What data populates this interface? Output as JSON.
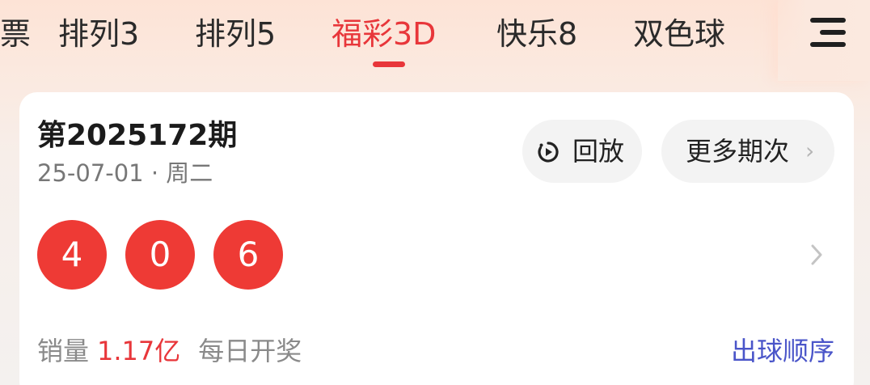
{
  "tabs": [
    {
      "label": "彩票"
    },
    {
      "label": "排列3"
    },
    {
      "label": "排列5"
    },
    {
      "label": "福彩3D",
      "active": true
    },
    {
      "label": "快乐8"
    },
    {
      "label": "双色球"
    }
  ],
  "colors": {
    "accent": "#e8363a",
    "ball": "#ee3a35",
    "link": "#4a55c9"
  },
  "card": {
    "issue": "第2025172期",
    "date": "25-07-01 · 周二",
    "replay_label": "回放",
    "more_label": "更多期次",
    "numbers": [
      "4",
      "0",
      "6"
    ],
    "sales_label": "销量",
    "sales_value": "1.17亿",
    "daily_label": "每日开奖",
    "order_link": "出球顺序"
  },
  "icons": {
    "menu": "hamburger-menu-icon",
    "replay": "replay-icon",
    "more": "chevron-right-icon"
  }
}
